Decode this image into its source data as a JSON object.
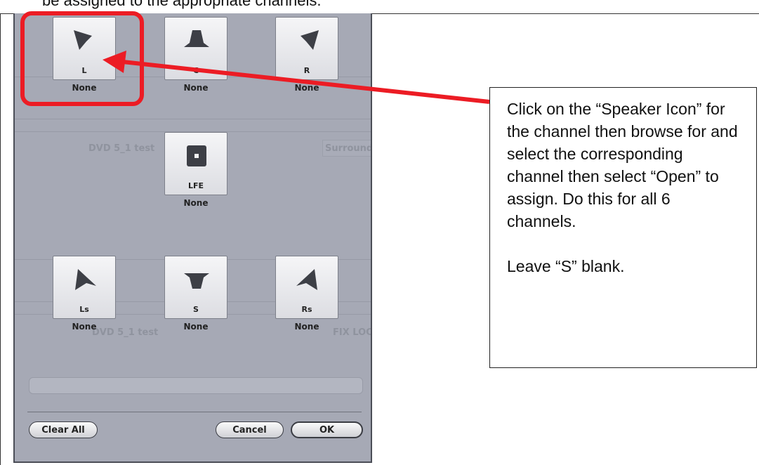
{
  "document": {
    "top_text": "be assigned to the appropriate channels."
  },
  "dialog": {
    "background_text": {
      "row1": "DVD 5_1 test",
      "row1_right": "Surround",
      "row2": "DVD 5_1 test",
      "row2_right": "FIX LOC"
    },
    "speakers": [
      {
        "id": "L",
        "label": "L",
        "value": "None",
        "icon": "speaker-front-left-icon"
      },
      {
        "id": "C",
        "label": "C",
        "value": "None",
        "icon": "speaker-center-icon"
      },
      {
        "id": "R",
        "label": "R",
        "value": "None",
        "icon": "speaker-front-right-icon"
      },
      {
        "id": "LFE",
        "label": "LFE",
        "value": "None",
        "icon": "subwoofer-icon"
      },
      {
        "id": "Ls",
        "label": "Ls",
        "value": "None",
        "icon": "speaker-surround-left-icon"
      },
      {
        "id": "S",
        "label": "S",
        "value": "None",
        "icon": "speaker-surround-icon"
      },
      {
        "id": "Rs",
        "label": "Rs",
        "value": "None",
        "icon": "speaker-surround-right-icon"
      }
    ],
    "buttons": {
      "clear_all": "Clear All",
      "cancel": "Cancel",
      "ok": "OK"
    }
  },
  "callout": {
    "text": "Click on the “Speaker Icon” for the channel then browse for and select the corresponding channel then select “Open” to assign.  Do this for all 6 channels.\n\nLeave “S” blank."
  },
  "colors": {
    "highlight": "#ec1c24",
    "dialog_bg": "#a6a9b5",
    "speaker_glyph": "#3d3f46"
  }
}
